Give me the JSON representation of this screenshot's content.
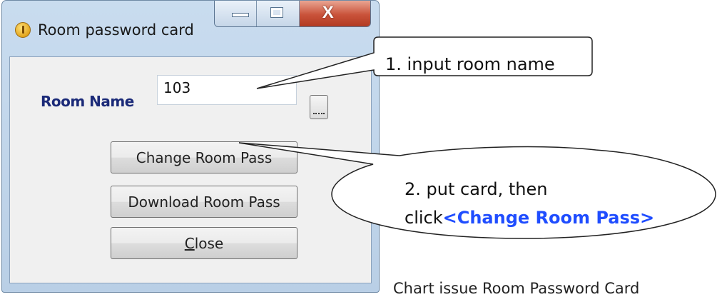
{
  "window": {
    "title": "Room password card",
    "buttons": {
      "minimize": "–",
      "maximize": "□",
      "close": "X"
    }
  },
  "form": {
    "room_name_label": "Room Name",
    "room_name_value": "103",
    "buttons": {
      "change": "Change Room Pass",
      "download": "Download Room Pass",
      "close_pre": "",
      "close_mnemonic": "C",
      "close_post": "lose"
    }
  },
  "callouts": {
    "step1": "1. input room name",
    "step2_line1": "2. put card, then",
    "step2_line2_prefix": "click",
    "step2_line2_highlight": "<Change Room Pass>"
  },
  "caption": "Chart    issue Room Password Card",
  "colors": {
    "label": "#1b2a78",
    "highlight": "#1f4dff"
  }
}
